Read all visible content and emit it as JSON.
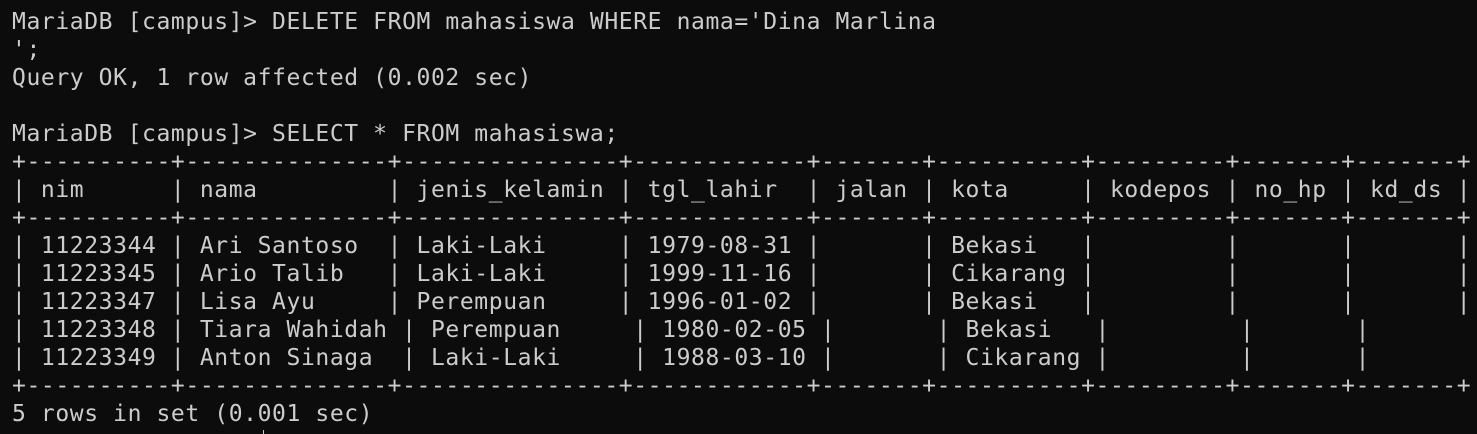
{
  "colors": {
    "background": "#0c0c0c",
    "text": "#cccccc"
  },
  "terminal": {
    "line1": "MariaDB [campus]> DELETE FROM mahasiswa WHERE nama='Dina Marlina",
    "line2": "';",
    "line3": "Query OK, 1 row affected (0.002 sec)",
    "line4": "",
    "line5": "MariaDB [campus]> SELECT * FROM mahasiswa;",
    "table_border_top": "+----------+--------------+---------------+------------+-------+----------+---------+-------+-------+",
    "table_header": "| nim      | nama         | jenis_kelamin | tgl_lahir  | jalan | kota     | kodepos | no_hp | kd_ds |",
    "table_border_mid": "+----------+--------------+---------------+------------+-------+----------+---------+-------+-------+",
    "rows": [
      "| 11223344 | Ari Santoso  | Laki-Laki     | 1979-08-31 |       | Bekasi   |         |       |       |",
      "| 11223345 | Ario Talib   | Laki-Laki     | 1999-11-16 |       | Cikarang |         |       |       |",
      "| 11223347 | Lisa Ayu     | Perempuan     | 1996-01-02 |       | Bekasi   |         |       |       |",
      "| 11223348 | Tiara Wahidah | Perempuan     | 1980-02-05 |       | Bekasi   |         |       |       |",
      "| 11223349 | Anton Sinaga  | Laki-Laki     | 1988-03-10 |       | Cikarang |         |       |       |"
    ],
    "table_border_bottom": "+----------+--------------+---------------+------------+-------+----------+---------+-------+-------+",
    "footer": "5 rows in set (0.001 sec)"
  }
}
